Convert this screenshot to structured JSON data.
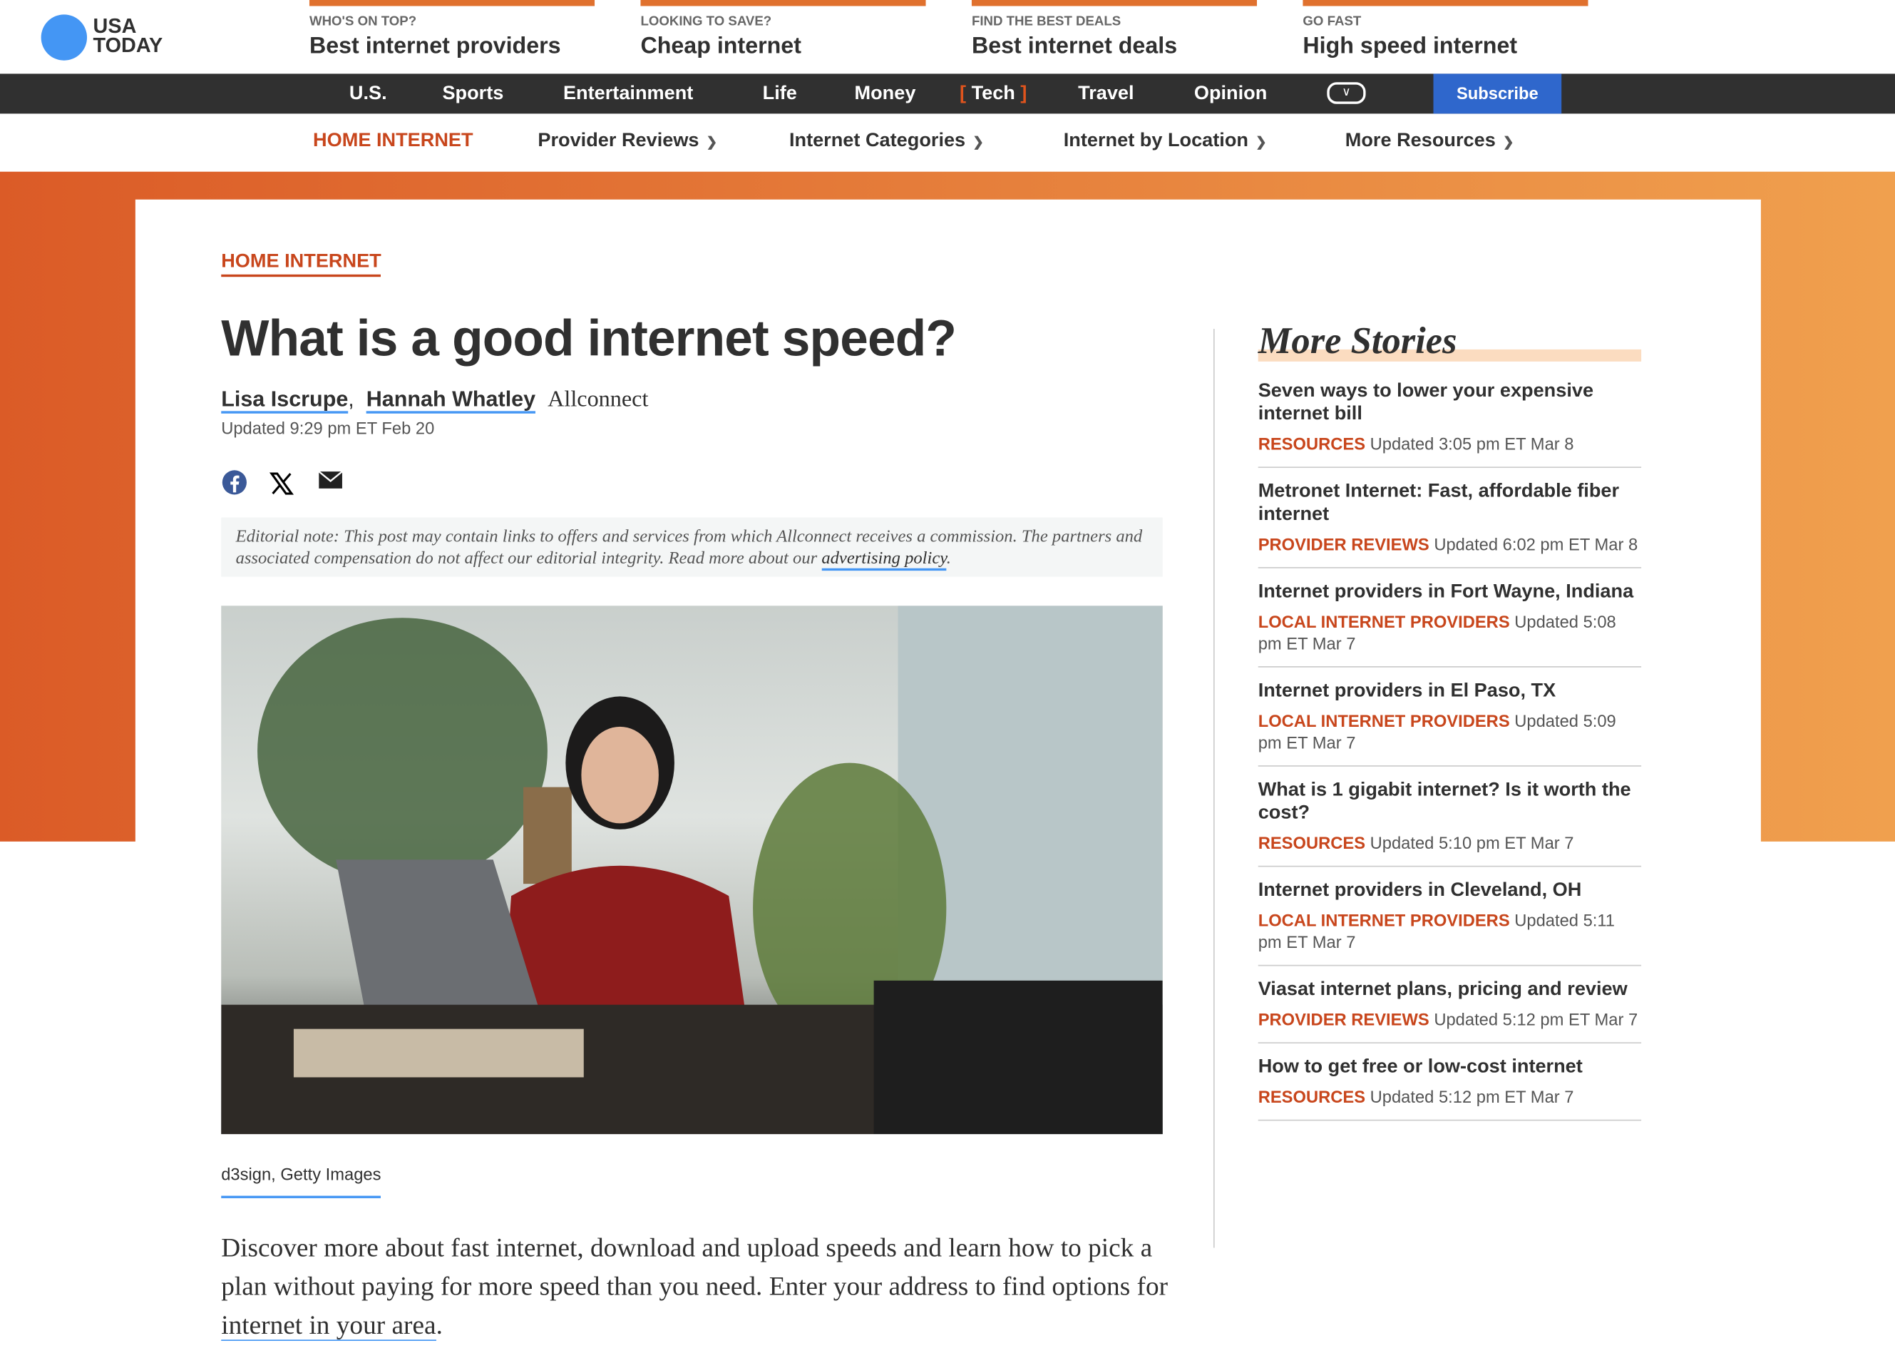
{
  "logo": {
    "line1": "USA",
    "line2": "TODAY"
  },
  "promos": [
    {
      "kicker": "WHO'S ON TOP?",
      "link": "Best internet providers"
    },
    {
      "kicker": "LOOKING TO SAVE?",
      "link": "Cheap internet"
    },
    {
      "kicker": "FIND THE BEST DEALS",
      "link": "Best internet deals"
    },
    {
      "kicker": "GO FAST",
      "link": "High speed internet"
    }
  ],
  "topnav": {
    "items": [
      "U.S.",
      "Sports",
      "Entertainment",
      "Life",
      "Money",
      "Tech",
      "Travel",
      "Opinion"
    ],
    "active": "Tech",
    "more_icon": "chevron-down-icon",
    "subscribe": "Subscribe"
  },
  "subnav": {
    "home": "HOME INTERNET",
    "items": [
      "Provider Reviews",
      "Internet Categories",
      "Internet by Location",
      "More Resources"
    ]
  },
  "article": {
    "section": "HOME INTERNET",
    "headline": "What is a good internet speed?",
    "authors": [
      "Lisa Iscrupe",
      "Hannah Whatley"
    ],
    "org": "Allconnect",
    "updated": "Updated 9:29 pm ET Feb 20",
    "share_icons": [
      "facebook-icon",
      "x-icon",
      "email-icon"
    ],
    "note": "Editorial note: This post may contain links to offers and services from which Allconnect receives a commission. The partners and associated compensation do not affect our editorial integrity. Read more about our ",
    "note_link": "advertising policy",
    "caption": "d3sign, Getty Images",
    "lede": "Discover more about fast internet, download and upload speeds and learn how to pick a plan without paying for more speed than you need. Enter your address to find options for ",
    "lede_link": "internet in your area",
    "lede_end": "."
  },
  "more_stories": {
    "title": "More Stories",
    "items": [
      {
        "title": "Seven ways to lower your expensive internet bill",
        "category": "RESOURCES",
        "updated": "Updated 3:05 pm ET Mar 8"
      },
      {
        "title": "Metronet Internet: Fast, affordable fiber internet",
        "category": "PROVIDER REVIEWS",
        "updated": "Updated 6:02 pm ET Mar 8"
      },
      {
        "title": "Internet providers in Fort Wayne, Indiana",
        "category": "LOCAL INTERNET PROVIDERS",
        "updated": "Updated 5:08 pm ET Mar 7"
      },
      {
        "title": "Internet providers in El Paso, TX",
        "category": "LOCAL INTERNET PROVIDERS",
        "updated": "Updated 5:09 pm ET Mar 7"
      },
      {
        "title": "What is 1 gigabit internet? Is it worth the cost?",
        "category": "RESOURCES",
        "updated": "Updated 5:10 pm ET Mar 7"
      },
      {
        "title": "Internet providers in Cleveland, OH",
        "category": "LOCAL INTERNET PROVIDERS",
        "updated": "Updated 5:11 pm ET Mar 7"
      },
      {
        "title": "Viasat internet plans, pricing and review",
        "category": "PROVIDER REVIEWS",
        "updated": "Updated 5:12 pm ET Mar 7"
      },
      {
        "title": "How to get free or low-cost internet",
        "category": "RESOURCES",
        "updated": "Updated 5:12 pm ET Mar 7"
      }
    ]
  },
  "colors": {
    "accent": "#c8461c",
    "brand_blue": "#4496f4",
    "subscribe": "#2f67cc",
    "nav_bg": "#303030",
    "promo_bar": "#e0712e"
  }
}
